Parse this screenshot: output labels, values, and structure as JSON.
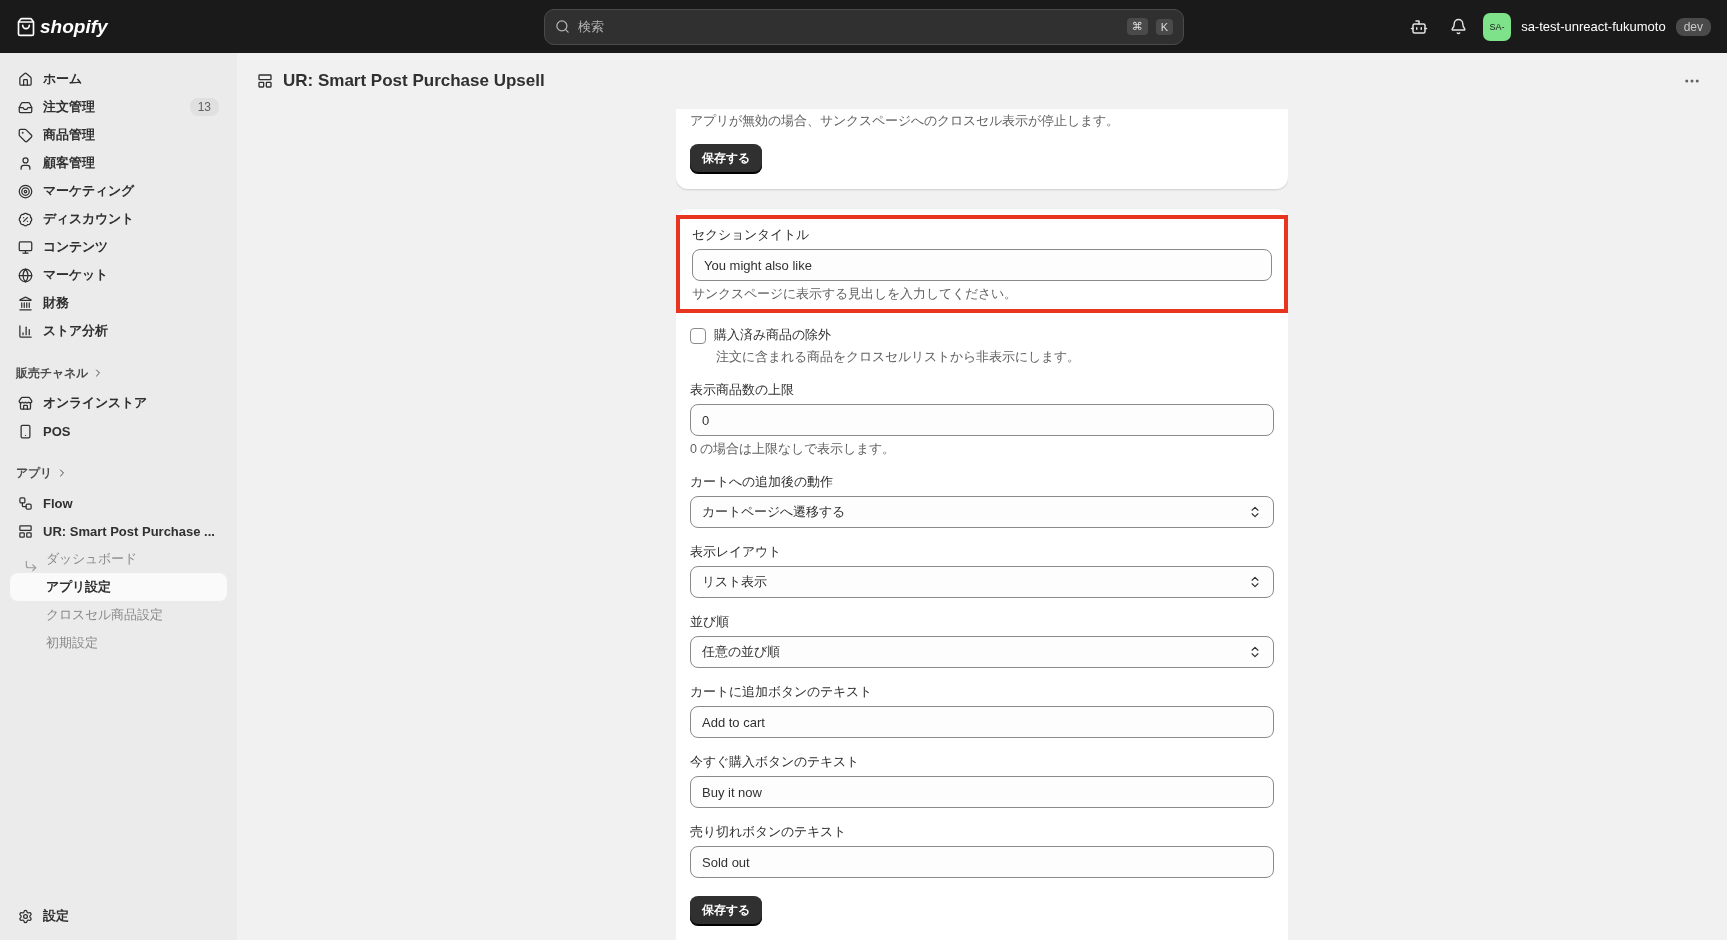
{
  "topbar": {
    "logo": "shopify",
    "search": {
      "placeholder": "検索",
      "shortcut": [
        "⌘",
        "K"
      ]
    },
    "avatar": "SA-",
    "store": "sa-test-unreact-fukumoto",
    "badge": "dev"
  },
  "sidebar": {
    "items": [
      {
        "label": "ホーム"
      },
      {
        "label": "注文管理",
        "count": "13"
      },
      {
        "label": "商品管理"
      },
      {
        "label": "顧客管理"
      },
      {
        "label": "マーケティング"
      },
      {
        "label": "ディスカウント"
      },
      {
        "label": "コンテンツ"
      },
      {
        "label": "マーケット"
      },
      {
        "label": "財務"
      },
      {
        "label": "ストア分析"
      }
    ],
    "channels": {
      "heading": "販売チャネル",
      "items": [
        {
          "label": "オンラインストア"
        },
        {
          "label": "POS"
        }
      ]
    },
    "apps": {
      "heading": "アプリ",
      "items": [
        {
          "label": "Flow"
        },
        {
          "label": "UR: Smart Post Purchase ...",
          "children": [
            {
              "label": "ダッシュボード",
              "selected": false
            },
            {
              "label": "アプリ設定",
              "selected": true
            },
            {
              "label": "クロスセル商品設定",
              "selected": false
            },
            {
              "label": "初期設定",
              "selected": false
            }
          ]
        }
      ]
    },
    "settings": "設定"
  },
  "page": {
    "title": "UR: Smart Post Purchase Upsell"
  },
  "status_card": {
    "description": "アプリが無効の場合、サンクスページへのクロスセル表示が停止します。",
    "save": "保存する"
  },
  "settings_card": {
    "fields": [
      {
        "kind": "text",
        "label": "セクションタイトル",
        "value": "You might also like",
        "help": "サンクスページに表示する見出しを入力してください。",
        "highlighted": true
      },
      {
        "kind": "checkbox",
        "label": "購入済み商品の除外",
        "checked": false,
        "help": "注文に含まれる商品をクロスセルリストから非表示にします。",
        "highlighted": false
      },
      {
        "kind": "text",
        "label": "表示商品数の上限",
        "value": "0",
        "help": "0 の場合は上限なしで表示します。",
        "highlighted": false
      },
      {
        "kind": "select",
        "label": "カートへの追加後の動作",
        "value": "カートページへ遷移する",
        "highlighted": false
      },
      {
        "kind": "select",
        "label": "表示レイアウト",
        "value": "リスト表示",
        "highlighted": false
      },
      {
        "kind": "select",
        "label": "並び順",
        "value": "任意の並び順",
        "highlighted": false
      },
      {
        "kind": "text",
        "label": "カートに追加ボタンのテキスト",
        "value": "Add to cart",
        "highlighted": false
      },
      {
        "kind": "text",
        "label": "今すぐ購入ボタンのテキスト",
        "value": "Buy it now",
        "highlighted": false
      },
      {
        "kind": "text",
        "label": "売り切れボタンのテキスト",
        "value": "Sold out",
        "highlighted": false
      }
    ],
    "save": "保存する"
  }
}
